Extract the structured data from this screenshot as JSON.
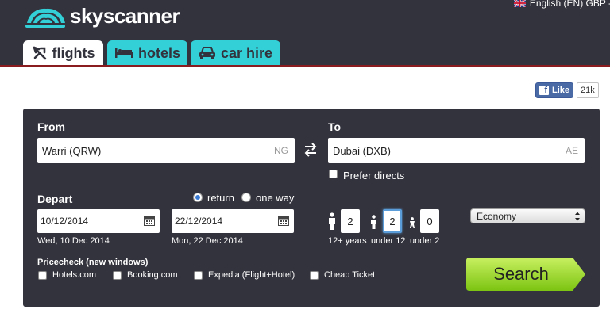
{
  "header": {
    "logo_text": "skyscanner",
    "locale": "English (EN) GBP -",
    "tabs": [
      {
        "label": "flights",
        "icon": "plane-icon",
        "active": true
      },
      {
        "label": "hotels",
        "icon": "bed-icon",
        "active": false
      },
      {
        "label": "car hire",
        "icon": "car-icon",
        "active": false
      }
    ]
  },
  "facebook": {
    "like_label": "Like",
    "count": "21k"
  },
  "search": {
    "from_label": "From",
    "from_value": "Warri (QRW)",
    "from_code": "NG",
    "to_label": "To",
    "to_value": "Dubai (DXB)",
    "to_code": "AE",
    "prefer_directs": "Prefer directs",
    "depart_label": "Depart",
    "trip_options": [
      "return",
      "one way"
    ],
    "trip_selected": "return",
    "depart_date": "10/12/2014",
    "depart_date_text": "Wed, 10 Dec 2014",
    "return_date": "22/12/2014",
    "return_date_text": "Mon, 22 Dec 2014",
    "passengers": [
      {
        "count": "2",
        "label": "12+ years"
      },
      {
        "count": "2",
        "label": "under 12"
      },
      {
        "count": "0",
        "label": "under 2"
      }
    ],
    "cabin_class": "Economy",
    "pricecheck_label": "Pricecheck (new windows)",
    "pricecheck_options": [
      "Hotels.com",
      "Booking.com",
      "Expedia (Flight+Hotel)",
      "Cheap Ticket"
    ],
    "search_button": "Search"
  },
  "colors": {
    "header_bg": "#33333d",
    "tab_inactive": "#33d0d8",
    "search_green": "#8fd11e"
  }
}
